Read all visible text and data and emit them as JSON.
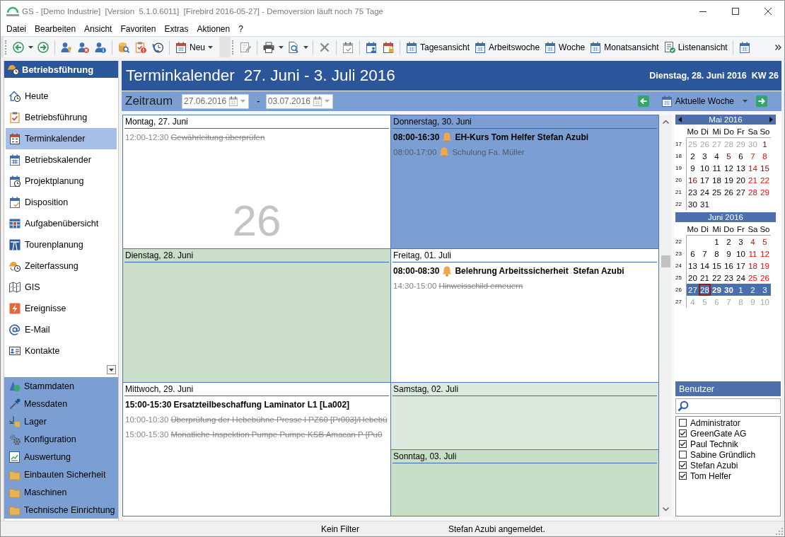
{
  "window": {
    "title": "GS - [Demo Industrie]  [Version  5.1.0.6011]  [Firebird 2016-05-27] - Demoversion läuft noch 75 Tage"
  },
  "menu": [
    "Datei",
    "Bearbeiten",
    "Ansicht",
    "Favoriten",
    "Extras",
    "Aktionen",
    "?"
  ],
  "toolbar": {
    "new_button": "Neu",
    "view_buttons": [
      "Tagesansicht",
      "Arbeitswoche",
      "Woche",
      "Monatsansicht",
      "Listenansicht"
    ]
  },
  "sidebar": {
    "title": "Betriebsführung",
    "items": [
      {
        "label": "Heute",
        "selected": false
      },
      {
        "label": "Betriebsführung",
        "selected": false
      },
      {
        "label": "Terminkalender",
        "selected": true
      },
      {
        "label": "Betriebskalender",
        "selected": false
      },
      {
        "label": "Projektplanung",
        "selected": false
      },
      {
        "label": "Disposition",
        "selected": false
      },
      {
        "label": "Aufgabenübersicht",
        "selected": false
      },
      {
        "label": "Tourenplanung",
        "selected": false
      },
      {
        "label": "Zeiterfassung",
        "selected": false
      },
      {
        "label": "GIS",
        "selected": false
      },
      {
        "label": "Ereignisse",
        "selected": false
      },
      {
        "label": "E-Mail",
        "selected": false
      },
      {
        "label": "Kontakte",
        "selected": false
      }
    ],
    "groups": [
      "Stammdaten",
      "Messdaten",
      "Lager",
      "Konfiguration",
      "Auswertung",
      "Einbauten Sicherheit",
      "Maschinen",
      "Technische Einrichtung"
    ]
  },
  "header": {
    "title": "Terminkalender",
    "range": "27. Juni - 3. Juli 2016",
    "date": "Dienstag, 28. Juni 2016",
    "week": "KW 26"
  },
  "period": {
    "label": "Zeitraum",
    "from": {
      "value": "27.06.2016",
      "disabled": true
    },
    "separator": "-",
    "to": {
      "value": "03.07.2016",
      "disabled": true
    },
    "view": "Aktuelle Woche"
  },
  "week_grid": {
    "week_number": "26",
    "days": [
      {
        "label": "Montag, 27. Juni",
        "kind": "workday",
        "today": false,
        "selected": false,
        "events": [
          {
            "time": "12:00-12:30",
            "title": "Gewährleitung überprüfen",
            "kind": "done",
            "reminder": false
          }
        ]
      },
      {
        "label": "Dienstag, 28. Juni",
        "kind": "workday",
        "today": true,
        "selected": false
      },
      {
        "label": "Mittwoch, 29. Juni",
        "kind": "workday",
        "today": false,
        "selected": false,
        "events": [
          {
            "time": "15:00-15:30",
            "title": "Ersatzteilbeschaffung Laminator L1 [La002]",
            "kind": "open",
            "reminder": false
          },
          {
            "time": "10:00-10:30",
            "title": "Überprüfung der Hebebühne Presse I PZ60 [Pr003]/Hebebü",
            "kind": "done",
            "reminder": false
          },
          {
            "time": "15:00-15:30",
            "title": "Monatliche Inspektion Pumpe Pumpe KSB Amacan P [Pu0",
            "kind": "done",
            "reminder": false
          }
        ]
      },
      {
        "label": "Donnerstag, 30. Juni",
        "kind": "workday",
        "today": false,
        "selected": true,
        "events": [
          {
            "time": "08:00-16:30",
            "title": "EH-Kurs Tom Helfer Stefan Azubi",
            "kind": "open",
            "reminder": true
          },
          {
            "time": "08:00-17:00",
            "title": "Schulung Fa. Müller",
            "kind": "other",
            "reminder": true
          }
        ]
      },
      {
        "label": "Freitag, 01. Juli",
        "kind": "workday",
        "today": false,
        "selected": false,
        "events": [
          {
            "time": "08:00-08:30",
            "title": "Belehrung Arbeitssicherheit  Stefan Azubi",
            "kind": "open",
            "reminder": true
          },
          {
            "time": "14:30-15:00",
            "title": "Hinweisschild erneuern",
            "kind": "done",
            "reminder": false
          }
        ]
      },
      {
        "label": "Samstag, 02. Juli",
        "kind": "saturday",
        "today": false,
        "selected": false
      },
      {
        "label": "Sonntag, 03. Juli",
        "kind": "sunday",
        "today": false,
        "selected": false
      }
    ]
  },
  "mini_calendar": {
    "months": [
      {
        "title": "Mai 2016",
        "weekdays": [
          "Mo",
          "Di",
          "Mi",
          "Do",
          "Fr",
          "Sa",
          "So"
        ],
        "weeks": [
          {
            "number": "17",
            "selected": false,
            "days": [
              {
                "label": "25",
                "kind": "other"
              },
              {
                "label": "26",
                "kind": "other"
              },
              {
                "label": "27",
                "kind": "other"
              },
              {
                "label": "28",
                "kind": "other"
              },
              {
                "label": "29",
                "kind": "other"
              },
              {
                "label": "30",
                "kind": "other"
              },
              {
                "label": "1",
                "kind": "holiday"
              }
            ]
          },
          {
            "number": "18",
            "selected": false,
            "days": [
              {
                "label": "2",
                "kind": "normal"
              },
              {
                "label": "3",
                "kind": "normal"
              },
              {
                "label": "4",
                "kind": "normal"
              },
              {
                "label": "5",
                "kind": "holiday"
              },
              {
                "label": "6",
                "kind": "normal"
              },
              {
                "label": "7",
                "kind": "weekend"
              },
              {
                "label": "8",
                "kind": "weekend"
              }
            ]
          },
          {
            "number": "19",
            "selected": false,
            "days": [
              {
                "label": "9",
                "kind": "normal"
              },
              {
                "label": "10",
                "kind": "normal"
              },
              {
                "label": "11",
                "kind": "normal"
              },
              {
                "label": "12",
                "kind": "normal"
              },
              {
                "label": "13",
                "kind": "normal"
              },
              {
                "label": "14",
                "kind": "weekend"
              },
              {
                "label": "15",
                "kind": "holiday"
              }
            ]
          },
          {
            "number": "20",
            "selected": false,
            "days": [
              {
                "label": "16",
                "kind": "holiday"
              },
              {
                "label": "17",
                "kind": "normal"
              },
              {
                "label": "18",
                "kind": "normal"
              },
              {
                "label": "19",
                "kind": "normal"
              },
              {
                "label": "20",
                "kind": "normal"
              },
              {
                "label": "21",
                "kind": "weekend"
              },
              {
                "label": "22",
                "kind": "weekend"
              }
            ]
          },
          {
            "number": "21",
            "selected": false,
            "days": [
              {
                "label": "23",
                "kind": "normal"
              },
              {
                "label": "24",
                "kind": "normal"
              },
              {
                "label": "25",
                "kind": "normal"
              },
              {
                "label": "26",
                "kind": "normal"
              },
              {
                "label": "27",
                "kind": "normal"
              },
              {
                "label": "28",
                "kind": "weekend"
              },
              {
                "label": "29",
                "kind": "weekend"
              }
            ]
          },
          {
            "number": "22",
            "selected": false,
            "days": [
              {
                "label": "30",
                "kind": "normal"
              },
              {
                "label": "31",
                "kind": "normal"
              }
            ]
          }
        ]
      },
      {
        "title": "Juni 2016",
        "weekdays": [
          "Mo",
          "Di",
          "Mi",
          "Do",
          "Fr",
          "Sa",
          "So"
        ],
        "weeks": [
          {
            "number": "22",
            "selected": false,
            "days": [
              {
                "kind": "blank"
              },
              {
                "kind": "blank"
              },
              {
                "label": "1",
                "kind": "normal"
              },
              {
                "label": "2",
                "kind": "normal"
              },
              {
                "label": "3",
                "kind": "normal"
              },
              {
                "label": "4",
                "kind": "weekend"
              },
              {
                "label": "5",
                "kind": "weekend"
              }
            ]
          },
          {
            "number": "23",
            "selected": false,
            "days": [
              {
                "label": "6",
                "kind": "normal"
              },
              {
                "label": "7",
                "kind": "normal"
              },
              {
                "label": "8",
                "kind": "normal"
              },
              {
                "label": "9",
                "kind": "normal"
              },
              {
                "label": "10",
                "kind": "normal"
              },
              {
                "label": "11",
                "kind": "weekend"
              },
              {
                "label": "12",
                "kind": "weekend"
              }
            ]
          },
          {
            "number": "24",
            "selected": false,
            "days": [
              {
                "label": "13",
                "kind": "normal"
              },
              {
                "label": "14",
                "kind": "normal"
              },
              {
                "label": "15",
                "kind": "normal"
              },
              {
                "label": "16",
                "kind": "normal"
              },
              {
                "label": "17",
                "kind": "normal"
              },
              {
                "label": "18",
                "kind": "weekend"
              },
              {
                "label": "19",
                "kind": "weekend"
              }
            ]
          },
          {
            "number": "25",
            "selected": false,
            "days": [
              {
                "label": "20",
                "kind": "normal"
              },
              {
                "label": "21",
                "kind": "normal"
              },
              {
                "label": "22",
                "kind": "normal"
              },
              {
                "label": "23",
                "kind": "normal"
              },
              {
                "label": "24",
                "kind": "normal"
              },
              {
                "label": "25",
                "kind": "weekend"
              },
              {
                "label": "26",
                "kind": "weekend"
              }
            ]
          },
          {
            "number": "26",
            "selected": true,
            "days": [
              {
                "label": "27",
                "kind": "normal"
              },
              {
                "label": "28",
                "kind": "today"
              },
              {
                "label": "29",
                "kind": "busy"
              },
              {
                "label": "30",
                "kind": "busy"
              },
              {
                "label": "1",
                "kind": "other"
              },
              {
                "label": "2",
                "kind": "other"
              },
              {
                "label": "3",
                "kind": "other"
              }
            ]
          },
          {
            "number": "27",
            "selected": false,
            "days": [
              {
                "label": "4",
                "kind": "other"
              },
              {
                "label": "5",
                "kind": "other"
              },
              {
                "label": "6",
                "kind": "other"
              },
              {
                "label": "7",
                "kind": "other"
              },
              {
                "label": "8",
                "kind": "other"
              },
              {
                "label": "9",
                "kind": "other"
              },
              {
                "label": "10",
                "kind": "other"
              }
            ]
          }
        ]
      }
    ]
  },
  "users": {
    "title": "Benutzer",
    "items": [
      {
        "label": "Administrator",
        "checked": false
      },
      {
        "label": "GreenGate AG",
        "checked": true
      },
      {
        "label": "Paul Technik",
        "checked": true
      },
      {
        "label": "Sabine Gründlich",
        "checked": false
      },
      {
        "label": "Stefan Azubi",
        "checked": true
      },
      {
        "label": "Tom Helfer",
        "checked": true
      }
    ]
  },
  "status_bar": [
    "Kein Filter",
    "Stefan Azubi angemeldet."
  ]
}
